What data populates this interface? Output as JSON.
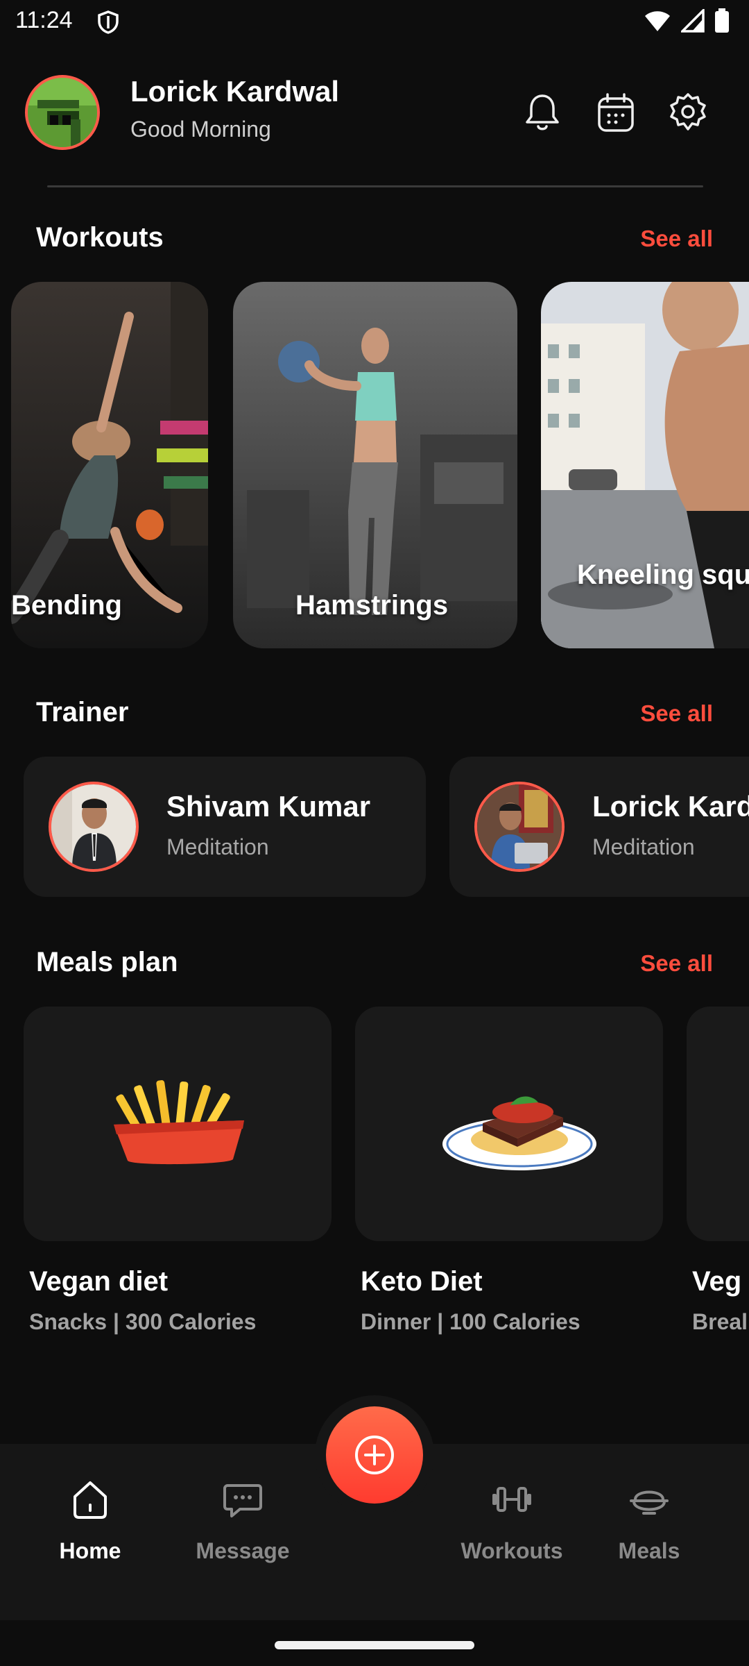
{
  "status_bar": {
    "time": "11:24"
  },
  "header": {
    "user_name": "Lorick Kardwal",
    "greeting": "Good Morning",
    "icons": [
      "bell-icon",
      "calendar-icon",
      "settings-gear-icon"
    ]
  },
  "workouts": {
    "title": "Workouts",
    "see_all": "See all",
    "cards": [
      {
        "label": "Bending"
      },
      {
        "label": "Hamstrings"
      },
      {
        "label": "Kneeling squ"
      }
    ]
  },
  "trainer": {
    "title": "Trainer",
    "see_all": "See all",
    "cards": [
      {
        "name": "Shivam Kumar",
        "role": "Meditation"
      },
      {
        "name": "Lorick Kard",
        "role": "Meditation"
      }
    ]
  },
  "meals": {
    "title": "Meals plan",
    "see_all": "See all",
    "cards": [
      {
        "title": "Vegan diet",
        "subtitle": "Snacks  |  300 Calories",
        "icon": "french-fries-icon"
      },
      {
        "title": "Keto Diet",
        "subtitle": "Dinner  |  100 Calories",
        "icon": "steak-pasta-plate-icon"
      },
      {
        "title": "Veg",
        "subtitle": "Breal"
      }
    ]
  },
  "bottom_nav": {
    "items": [
      {
        "label": "Home",
        "icon": "home-icon",
        "active": true
      },
      {
        "label": "Message",
        "icon": "message-icon",
        "active": false
      },
      {
        "label": "Workouts",
        "icon": "dumbbell-icon",
        "active": false
      },
      {
        "label": "Meals",
        "icon": "meal-bowl-icon",
        "active": false
      }
    ],
    "fab_icon": "add-circle-icon"
  },
  "colors": {
    "accent": "#ff4d3d",
    "background": "#0d0d0d",
    "card": "#1a1a1a",
    "nav_background": "#161616"
  }
}
